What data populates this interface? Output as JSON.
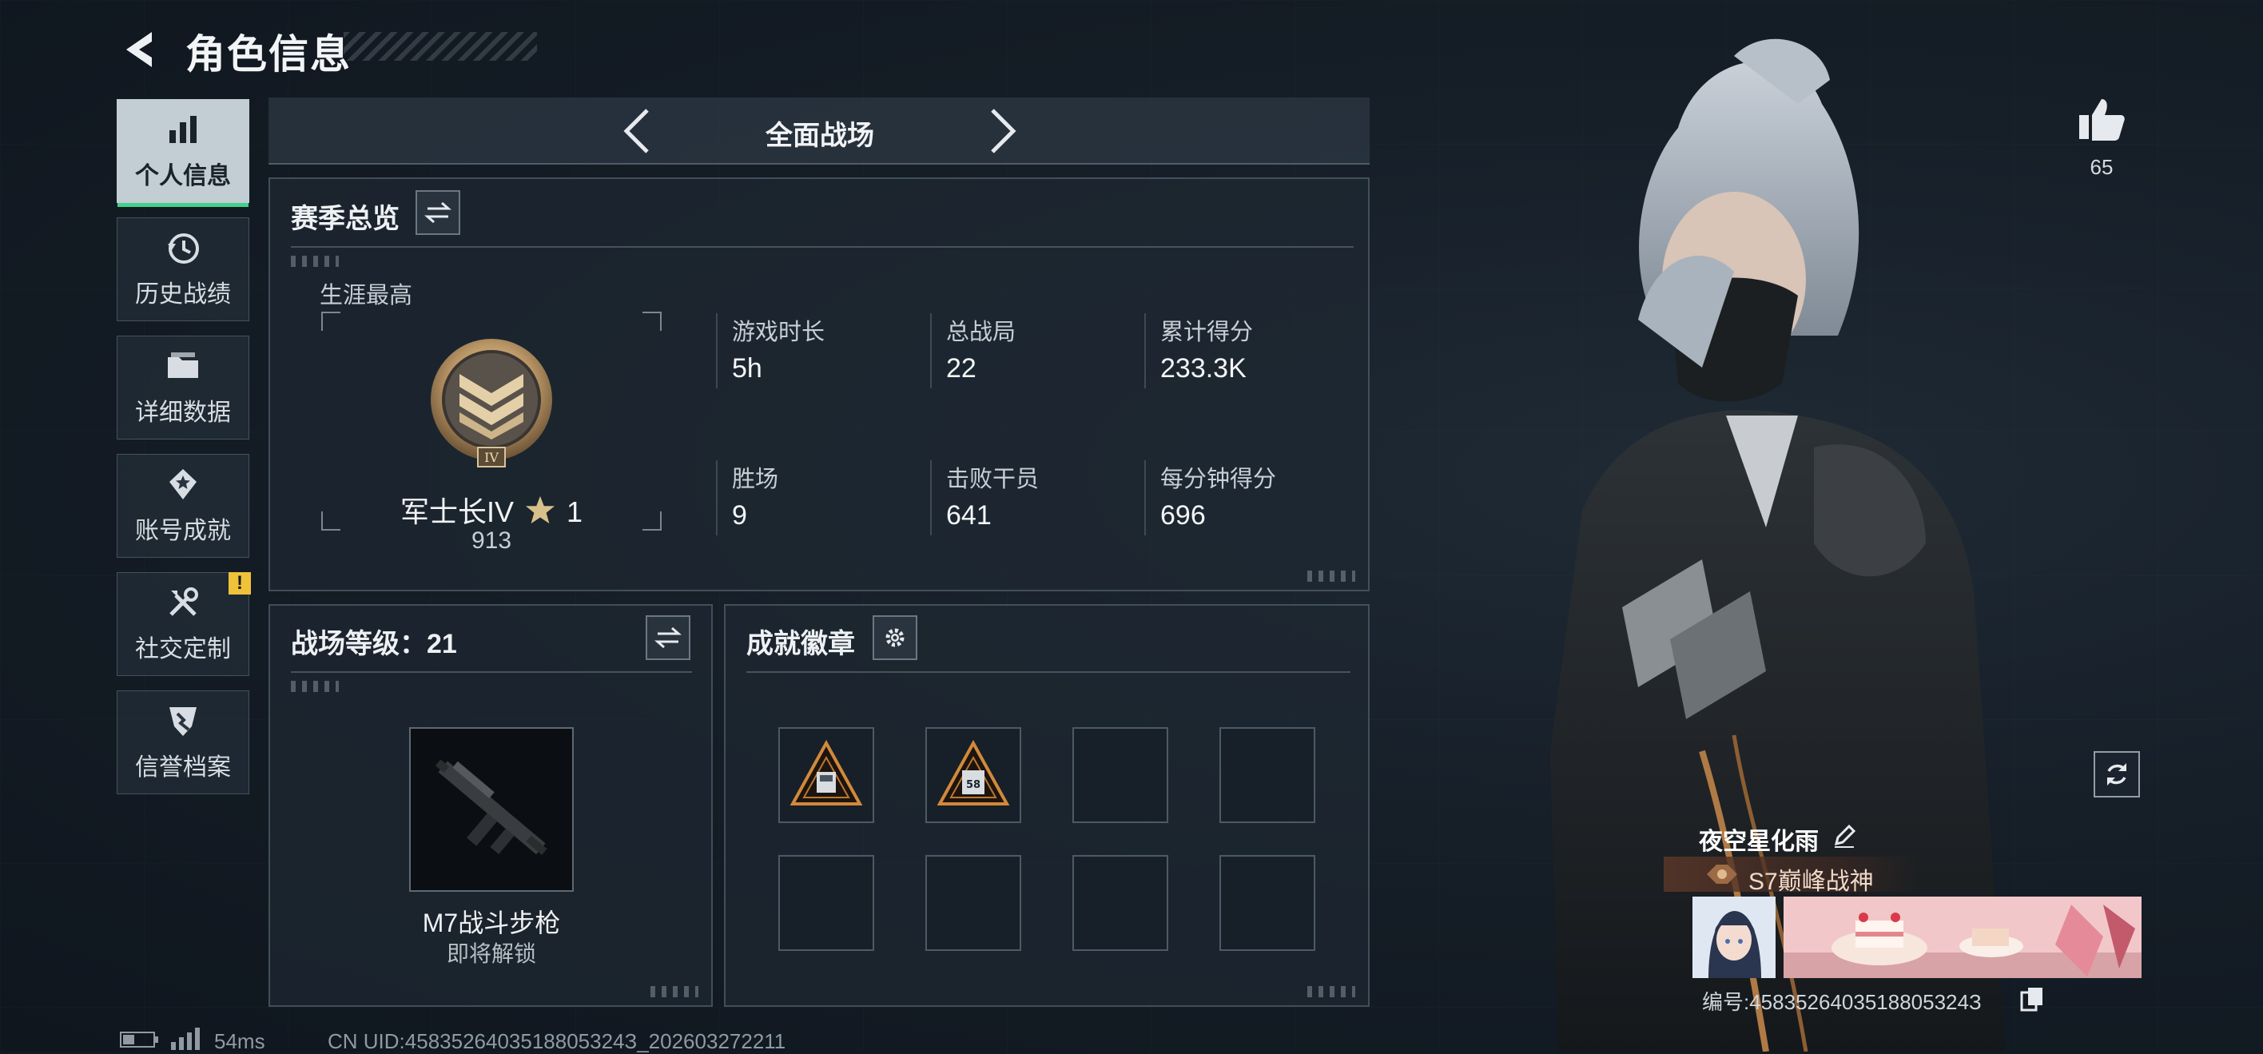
{
  "header": {
    "title": "角色信息"
  },
  "sidebar": {
    "items": [
      {
        "label": "个人信息",
        "icon": "bar-chart-icon",
        "active": true
      },
      {
        "label": "历史战绩",
        "icon": "history-clock-icon"
      },
      {
        "label": "详细数据",
        "icon": "folder-icon"
      },
      {
        "label": "账号成就",
        "icon": "achievement-icon"
      },
      {
        "label": "社交定制",
        "icon": "tools-icon",
        "badge": "!"
      },
      {
        "label": "信誉档案",
        "icon": "shield-icon"
      }
    ]
  },
  "mode": {
    "label": "全面战场"
  },
  "season": {
    "title": "赛季总览",
    "career_label": "生涯最高",
    "rank_name": "军士长IV",
    "rank_stars": "1",
    "rank_score": "913",
    "stats": [
      {
        "label": "游戏时长",
        "value": "5h"
      },
      {
        "label": "总战局",
        "value": "22"
      },
      {
        "label": "累计得分",
        "value": "233.3K"
      },
      {
        "label": "胜场",
        "value": "9"
      },
      {
        "label": "击败干员",
        "value": "641"
      },
      {
        "label": "每分钟得分",
        "value": "696"
      }
    ]
  },
  "battle_level": {
    "title": "战场等级：21",
    "weapon_name": "M7战斗步枪",
    "weapon_status": "即将解锁"
  },
  "achievements": {
    "title": "成就徽章",
    "badge_numbers": [
      "",
      "58"
    ]
  },
  "profile": {
    "likes": "65",
    "name": "夜空星化雨",
    "title": "S7巅峰战神",
    "id_text": "编号:4583526403518805324З"
  },
  "status_bar": {
    "ping": "54ms",
    "uid": "CN UID:4583526403518805324З_202603272211"
  },
  "colors": {
    "accent": "#41d28b",
    "warning": "#f0c23a"
  }
}
